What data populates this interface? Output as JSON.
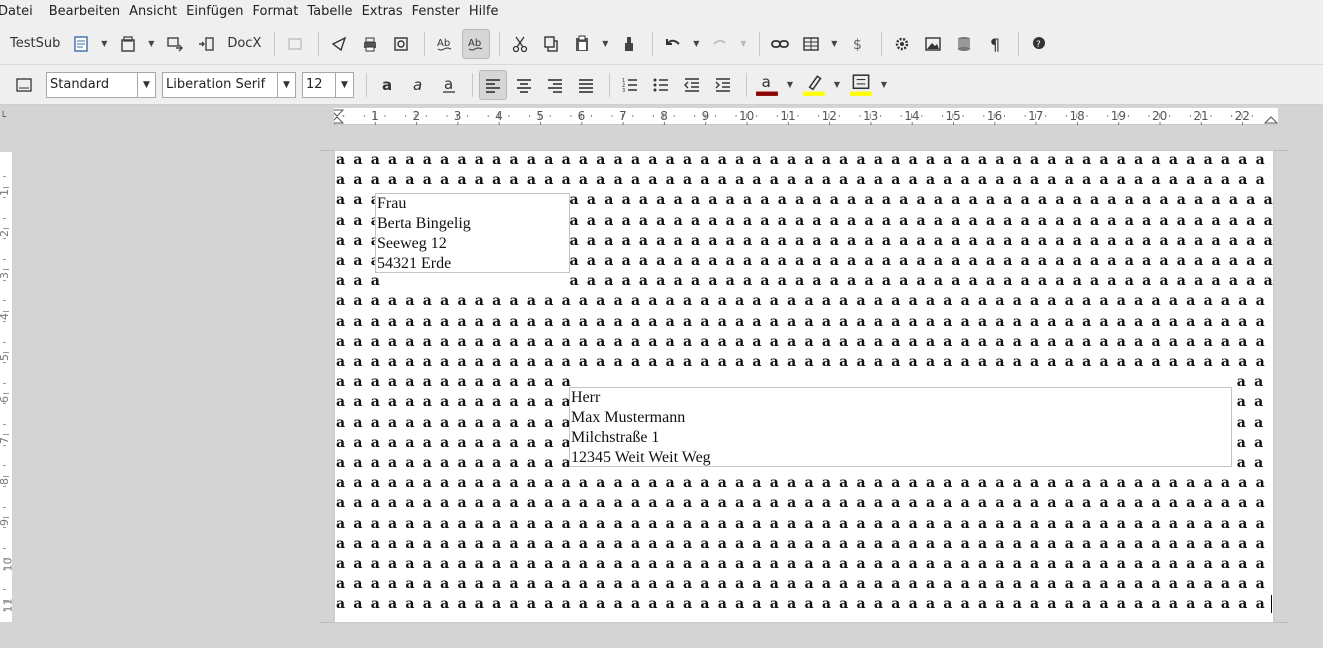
{
  "menu": [
    "Datei",
    "Bearbeiten",
    "Ansicht",
    "Einfügen",
    "Format",
    "Tabelle",
    "Extras",
    "Fenster",
    "Hilfe"
  ],
  "toolbar": {
    "testsub_label": "TestSub",
    "docx_label": "DocX"
  },
  "format": {
    "style": "Standard",
    "font": "Liberation Serif",
    "size": "12"
  },
  "ruler": {
    "numbers": [
      "1",
      "2",
      "3",
      "4",
      "5",
      "6",
      "7",
      "8",
      "9",
      "10",
      "11",
      "12",
      "13",
      "14",
      "15",
      "16",
      "17",
      "18",
      "19",
      "20",
      "21",
      "22"
    ],
    "vertical_numbers": [
      "1",
      "2",
      "3",
      "4",
      "5",
      "6",
      "7",
      "8",
      "9",
      "10",
      "11"
    ]
  },
  "document": {
    "filler_char": "a",
    "frame1": [
      "Frau",
      "Berta Bingelig",
      "Seeweg 12",
      "54321 Erde"
    ],
    "frame2": [
      "Herr",
      "Max Mustermann",
      "Milchstraße 1",
      "12345 Weit Weit Weg"
    ]
  },
  "colors": {
    "font_color": "#8b0000",
    "highlight": "#ffff00",
    "background_fill": "#ffff00"
  }
}
